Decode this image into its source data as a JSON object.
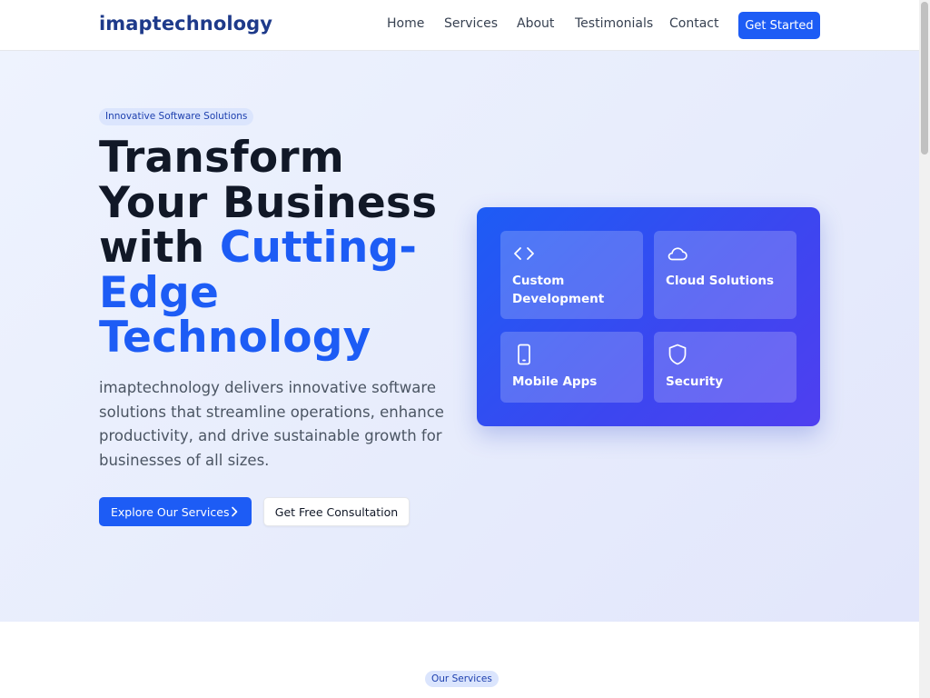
{
  "header": {
    "logo": "imaptechnology",
    "nav": [
      "Home",
      "Services",
      "About",
      "Testimonials",
      "Contact"
    ],
    "cta": "Get Started"
  },
  "hero": {
    "badge": "Innovative Software Solutions",
    "title_line1": "Transform",
    "title_line2": "Your Business",
    "title_line3_plain": "with ",
    "title_accent": "Cutting-Edge Technology",
    "description": "imaptechnology delivers innovative software solutions that streamline operations, enhance productivity, and drive sustainable growth for businesses of all sizes.",
    "primary_button": "Explore Our Services",
    "secondary_button": "Get Free Consultation"
  },
  "feature_card": {
    "tiles": [
      {
        "label": "Custom Development",
        "icon": "code-icon"
      },
      {
        "label": "Cloud Solutions",
        "icon": "cloud-icon"
      },
      {
        "label": "Mobile Apps",
        "icon": "smartphone-icon"
      },
      {
        "label": "Security",
        "icon": "shield-icon"
      }
    ]
  },
  "services_section": {
    "badge": "Our Services"
  },
  "colors": {
    "brand_blue": "#1d5cf5",
    "logo_navy": "#1e3a8a",
    "heading_dark": "#111827"
  }
}
